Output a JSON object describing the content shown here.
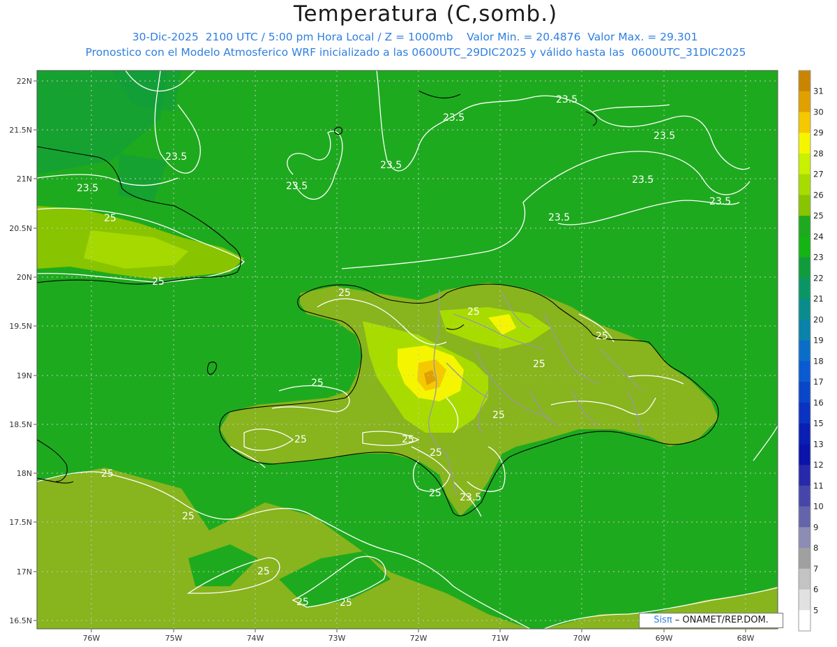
{
  "title": "Temperatura (C,somb.)",
  "subtitle_line1": "30-Dic-2025  2100 UTC / 5:00 pm Hora Local / Z = 1000mb    Valor Min. = 20.4876  Valor Max. = 29.301",
  "subtitle_line2": "Pronostico con el Modelo Atmosferico WRF inicializado a las 0600UTC_29DIC2025 y válido hasta las  0600UTC_31DIC2025",
  "credit_sis": "Sisπ",
  "credit_rest": " – ONAMET/REP.DOM.",
  "map": {
    "lat_ticks": [
      "22N",
      "21.5N",
      "21N",
      "20.5N",
      "20N",
      "19.5N",
      "19N",
      "18.5N",
      "18N",
      "17.5N",
      "17N",
      "16.5N"
    ],
    "lon_ticks": [
      "76W",
      "75W",
      "74W",
      "73W",
      "72W",
      "71W",
      "70W",
      "69W",
      "68W"
    ],
    "contour_labels": [
      "23.5",
      "23.5",
      "23.5",
      "23.5",
      "23.5",
      "23.5",
      "23.5",
      "23.5",
      "23.5",
      "23.5",
      "25",
      "25",
      "25",
      "25",
      "25",
      "25",
      "25",
      "25",
      "25",
      "25",
      "25",
      "25",
      "25",
      "25",
      "25",
      "23.5"
    ]
  },
  "colorbar": {
    "levels": [
      "31",
      "30",
      "29",
      "28",
      "27",
      "26",
      "25",
      "24",
      "23",
      "22",
      "21",
      "20",
      "19",
      "18",
      "17",
      "16",
      "15",
      "13",
      "12",
      "11",
      "10",
      "9",
      "8",
      "7",
      "6",
      "5"
    ],
    "colors": [
      "#c98500",
      "#e0a000",
      "#f5c800",
      "#f5f500",
      "#c8f000",
      "#a8dc00",
      "#88c400",
      "#1eaa1e",
      "#14b414",
      "#109c3c",
      "#0a9664",
      "#0a8c8c",
      "#0a82aa",
      "#0a6ec8",
      "#0a5ad2",
      "#0a46c8",
      "#0a32c3",
      "#0a1eb4",
      "#0a14aa",
      "#2828aa",
      "#4646aa",
      "#6464aa",
      "#8c8cb4",
      "#a0a0a0",
      "#c3c3c3",
      "#e1e1e1"
    ],
    "last_color": "#ffffff"
  }
}
